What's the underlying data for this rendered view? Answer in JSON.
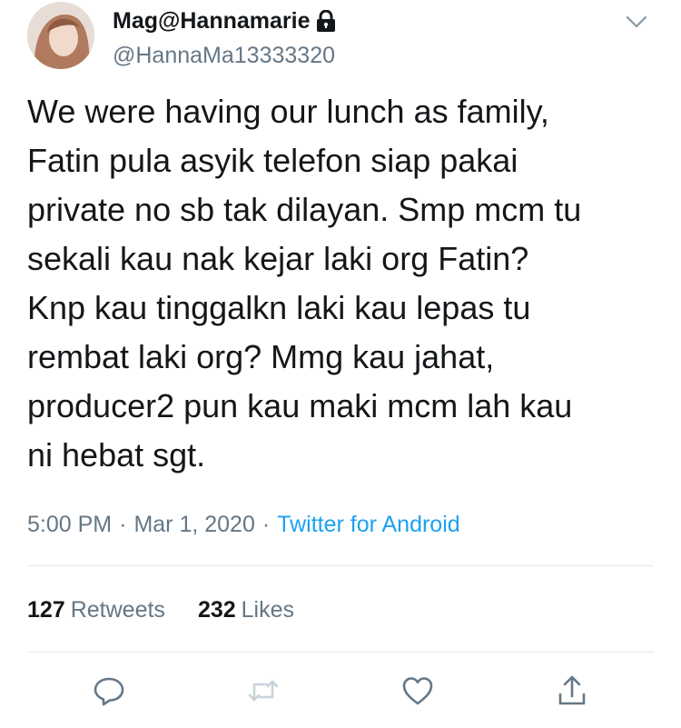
{
  "author": {
    "display_name": "Mag@Hannamarie",
    "handle": "@HannaMa13333320"
  },
  "icons": {
    "protected": "lock-icon",
    "menu": "chevron-down-icon",
    "reply": "reply-icon",
    "retweet": "retweet-icon",
    "like": "heart-icon",
    "share": "share-icon"
  },
  "tweet": {
    "lines": [
      "We were having our lunch as family,",
      "Fatin pula asyik telefon siap pakai",
      "private no sb tak dilayan. Smp mcm tu",
      "sekali kau nak kejar laki org Fatin?",
      "Knp kau tinggalkn laki kau lepas tu",
      "rembat laki org? Mmg kau jahat,",
      "producer2 pun kau maki mcm lah kau",
      "ni hebat sgt."
    ]
  },
  "meta": {
    "time": "5:00 PM",
    "separator": "·",
    "date": "Mar 1, 2020",
    "source": "Twitter for Android"
  },
  "stats": {
    "retweets_count": "127",
    "retweets_label": "Retweets",
    "likes_count": "232",
    "likes_label": "Likes"
  },
  "colors": {
    "text": "#14171a",
    "secondary": "#657786",
    "accent": "#1da1f2",
    "divider": "#e1e8ed"
  }
}
